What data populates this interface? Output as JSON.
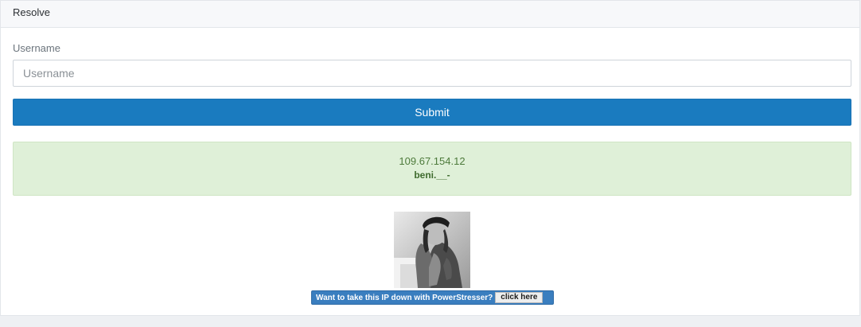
{
  "header": {
    "title": "Resolve"
  },
  "form": {
    "username_label": "Username",
    "username_value": "",
    "username_placeholder": "Username",
    "submit_label": "Submit"
  },
  "result": {
    "ip": "109.67.154.12",
    "username": "beni.__-"
  },
  "photo": {
    "description_icon": "profile-photo"
  },
  "ad": {
    "text": "Want to take this IP down with PowerStresser?",
    "button_label": "click here"
  },
  "colors": {
    "primary": "#1a7bbf",
    "success_bg": "#dff0d8",
    "success_text": "#4d7a3b",
    "ad_bg": "#3a7ebf"
  }
}
